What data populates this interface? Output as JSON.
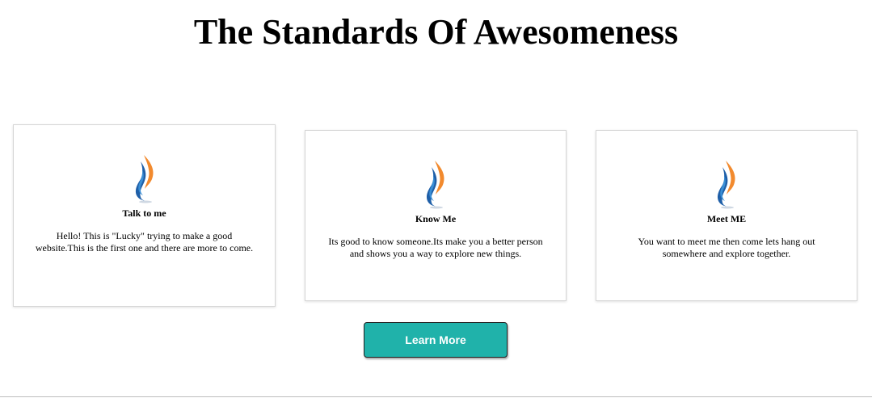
{
  "page": {
    "title": "The Standards Of Awesomeness"
  },
  "cards": [
    {
      "heading": "Talk to me",
      "text": "Hello! This is \"Lucky\" trying to make a good website.This is the first one and there are more to come.",
      "icon": "flame-logo-icon"
    },
    {
      "heading": "Know Me",
      "text": "Its good to know someone.Its make you a better person and shows you a way to explore new things.",
      "icon": "flame-logo-icon"
    },
    {
      "heading": "Meet ME",
      "text": "You want to meet me then come lets hang out somewhere and explore together.",
      "icon": "flame-logo-icon"
    }
  ],
  "cta": {
    "label": "Learn More"
  },
  "colors": {
    "button_bg": "#20b2aa",
    "logo_orange": "#f28a2e",
    "logo_blue": "#1f5fa8"
  }
}
